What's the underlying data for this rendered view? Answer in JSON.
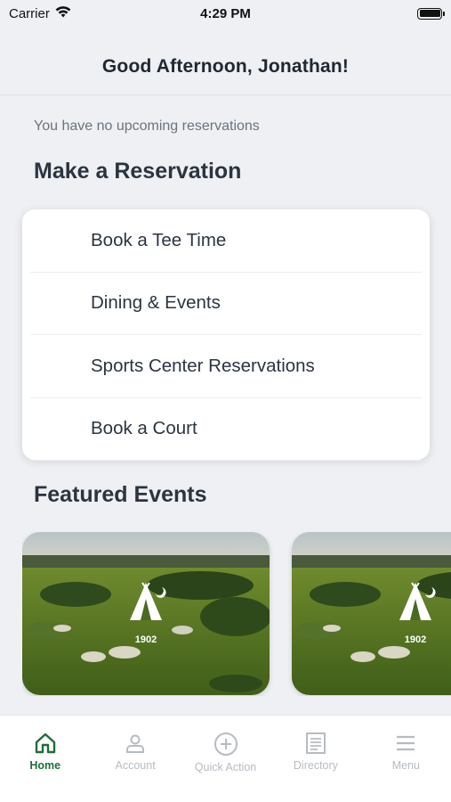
{
  "status_bar": {
    "carrier": "Carrier",
    "time": "4:29 PM"
  },
  "header": {
    "greeting": "Good Afternoon, Jonathan!"
  },
  "reservations": {
    "empty_message": "You have no upcoming reservations",
    "section_title": "Make a Reservation",
    "items": [
      {
        "label": "Book a Tee Time"
      },
      {
        "label": "Dining & Events"
      },
      {
        "label": "Sports Center Reservations"
      },
      {
        "label": "Book a Court"
      }
    ]
  },
  "featured": {
    "section_title": "Featured Events",
    "cards": [
      {
        "logo_year": "1902"
      },
      {
        "logo_year": "1902"
      }
    ]
  },
  "tab_bar": {
    "tabs": [
      {
        "label": "Home",
        "icon": "home-icon",
        "active": true
      },
      {
        "label": "Account",
        "icon": "account-icon",
        "active": false
      },
      {
        "label": "Quick Action",
        "icon": "plus-circle-icon",
        "active": false
      },
      {
        "label": "Directory",
        "icon": "directory-icon",
        "active": false
      },
      {
        "label": "Menu",
        "icon": "menu-icon",
        "active": false
      }
    ]
  },
  "colors": {
    "accent": "#1f6e3a",
    "inactive_tab": "#b7bcc2",
    "background": "#eef0f3"
  }
}
